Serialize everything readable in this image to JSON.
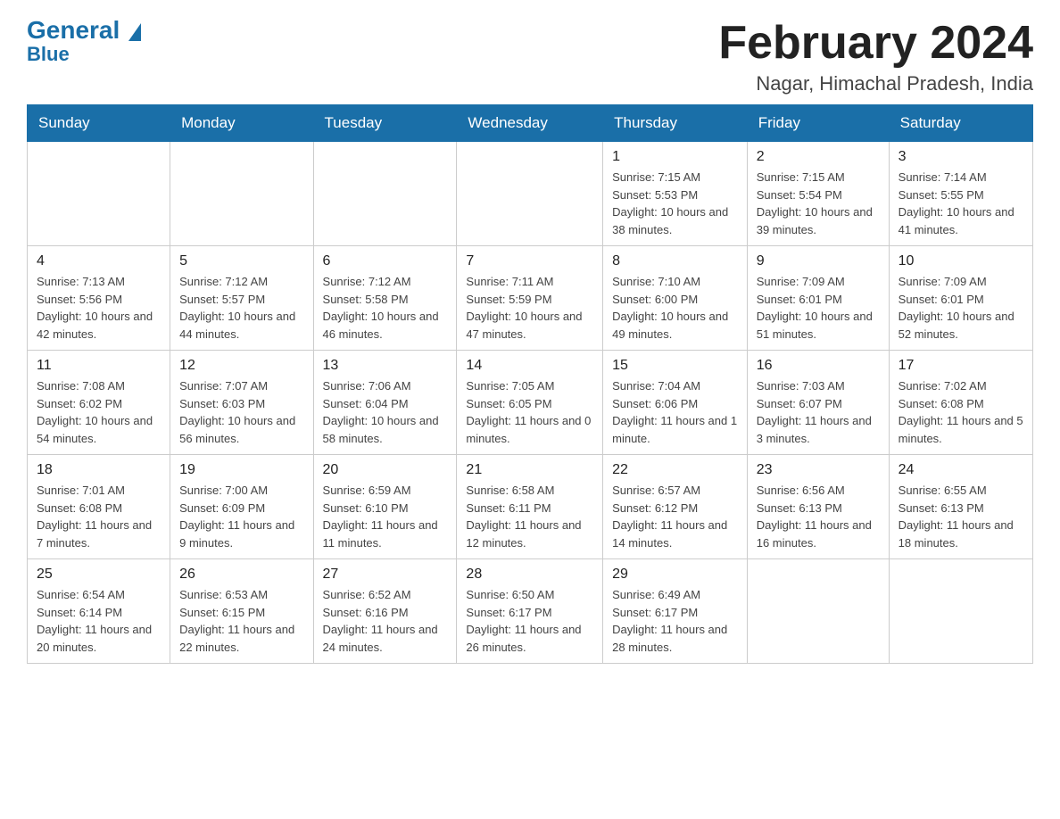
{
  "header": {
    "logo_general": "General",
    "logo_blue": "Blue",
    "month_title": "February 2024",
    "location": "Nagar, Himachal Pradesh, India"
  },
  "weekdays": [
    "Sunday",
    "Monday",
    "Tuesday",
    "Wednesday",
    "Thursday",
    "Friday",
    "Saturday"
  ],
  "weeks": [
    [
      {
        "day": "",
        "info": ""
      },
      {
        "day": "",
        "info": ""
      },
      {
        "day": "",
        "info": ""
      },
      {
        "day": "",
        "info": ""
      },
      {
        "day": "1",
        "info": "Sunrise: 7:15 AM\nSunset: 5:53 PM\nDaylight: 10 hours and 38 minutes."
      },
      {
        "day": "2",
        "info": "Sunrise: 7:15 AM\nSunset: 5:54 PM\nDaylight: 10 hours and 39 minutes."
      },
      {
        "day": "3",
        "info": "Sunrise: 7:14 AM\nSunset: 5:55 PM\nDaylight: 10 hours and 41 minutes."
      }
    ],
    [
      {
        "day": "4",
        "info": "Sunrise: 7:13 AM\nSunset: 5:56 PM\nDaylight: 10 hours and 42 minutes."
      },
      {
        "day": "5",
        "info": "Sunrise: 7:12 AM\nSunset: 5:57 PM\nDaylight: 10 hours and 44 minutes."
      },
      {
        "day": "6",
        "info": "Sunrise: 7:12 AM\nSunset: 5:58 PM\nDaylight: 10 hours and 46 minutes."
      },
      {
        "day": "7",
        "info": "Sunrise: 7:11 AM\nSunset: 5:59 PM\nDaylight: 10 hours and 47 minutes."
      },
      {
        "day": "8",
        "info": "Sunrise: 7:10 AM\nSunset: 6:00 PM\nDaylight: 10 hours and 49 minutes."
      },
      {
        "day": "9",
        "info": "Sunrise: 7:09 AM\nSunset: 6:01 PM\nDaylight: 10 hours and 51 minutes."
      },
      {
        "day": "10",
        "info": "Sunrise: 7:09 AM\nSunset: 6:01 PM\nDaylight: 10 hours and 52 minutes."
      }
    ],
    [
      {
        "day": "11",
        "info": "Sunrise: 7:08 AM\nSunset: 6:02 PM\nDaylight: 10 hours and 54 minutes."
      },
      {
        "day": "12",
        "info": "Sunrise: 7:07 AM\nSunset: 6:03 PM\nDaylight: 10 hours and 56 minutes."
      },
      {
        "day": "13",
        "info": "Sunrise: 7:06 AM\nSunset: 6:04 PM\nDaylight: 10 hours and 58 minutes."
      },
      {
        "day": "14",
        "info": "Sunrise: 7:05 AM\nSunset: 6:05 PM\nDaylight: 11 hours and 0 minutes."
      },
      {
        "day": "15",
        "info": "Sunrise: 7:04 AM\nSunset: 6:06 PM\nDaylight: 11 hours and 1 minute."
      },
      {
        "day": "16",
        "info": "Sunrise: 7:03 AM\nSunset: 6:07 PM\nDaylight: 11 hours and 3 minutes."
      },
      {
        "day": "17",
        "info": "Sunrise: 7:02 AM\nSunset: 6:08 PM\nDaylight: 11 hours and 5 minutes."
      }
    ],
    [
      {
        "day": "18",
        "info": "Sunrise: 7:01 AM\nSunset: 6:08 PM\nDaylight: 11 hours and 7 minutes."
      },
      {
        "day": "19",
        "info": "Sunrise: 7:00 AM\nSunset: 6:09 PM\nDaylight: 11 hours and 9 minutes."
      },
      {
        "day": "20",
        "info": "Sunrise: 6:59 AM\nSunset: 6:10 PM\nDaylight: 11 hours and 11 minutes."
      },
      {
        "day": "21",
        "info": "Sunrise: 6:58 AM\nSunset: 6:11 PM\nDaylight: 11 hours and 12 minutes."
      },
      {
        "day": "22",
        "info": "Sunrise: 6:57 AM\nSunset: 6:12 PM\nDaylight: 11 hours and 14 minutes."
      },
      {
        "day": "23",
        "info": "Sunrise: 6:56 AM\nSunset: 6:13 PM\nDaylight: 11 hours and 16 minutes."
      },
      {
        "day": "24",
        "info": "Sunrise: 6:55 AM\nSunset: 6:13 PM\nDaylight: 11 hours and 18 minutes."
      }
    ],
    [
      {
        "day": "25",
        "info": "Sunrise: 6:54 AM\nSunset: 6:14 PM\nDaylight: 11 hours and 20 minutes."
      },
      {
        "day": "26",
        "info": "Sunrise: 6:53 AM\nSunset: 6:15 PM\nDaylight: 11 hours and 22 minutes."
      },
      {
        "day": "27",
        "info": "Sunrise: 6:52 AM\nSunset: 6:16 PM\nDaylight: 11 hours and 24 minutes."
      },
      {
        "day": "28",
        "info": "Sunrise: 6:50 AM\nSunset: 6:17 PM\nDaylight: 11 hours and 26 minutes."
      },
      {
        "day": "29",
        "info": "Sunrise: 6:49 AM\nSunset: 6:17 PM\nDaylight: 11 hours and 28 minutes."
      },
      {
        "day": "",
        "info": ""
      },
      {
        "day": "",
        "info": ""
      }
    ]
  ]
}
